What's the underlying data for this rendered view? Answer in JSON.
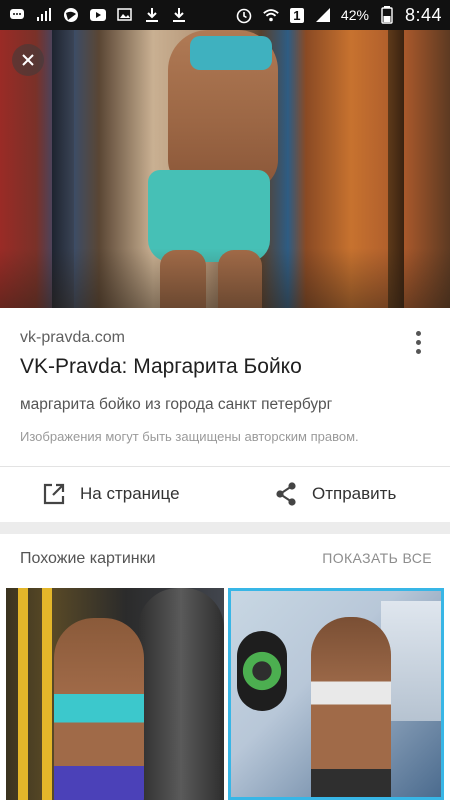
{
  "status_bar": {
    "battery_percent": "42%",
    "time": "8:44",
    "left_icons": [
      "messages-icon",
      "signal-bars-icon",
      "globe-icon",
      "youtube-icon",
      "image-icon",
      "download-icon",
      "download-icon"
    ],
    "right_icons": [
      "alarm-icon",
      "wifi-icon",
      "sim-1-icon",
      "cell-signal-icon"
    ],
    "sim_label": "1"
  },
  "hero": {
    "close_icon": "close-icon"
  },
  "result": {
    "domain": "vk-pravda.com",
    "title": "VK-Pravda: Маргарита Бойко",
    "description": "маргарита бойко из города санкт петербург",
    "copyright_notice": "Изображения могут быть защищены авторским правом.",
    "actions": {
      "open_label": "На странице",
      "share_label": "Отправить"
    }
  },
  "related": {
    "title": "Похожие картинки",
    "show_all_label": "ПОКАЗАТЬ ВСЕ"
  },
  "colors": {
    "status_bar": "#111111",
    "accent_selection": "#38b6e6",
    "background": "#ececec"
  }
}
